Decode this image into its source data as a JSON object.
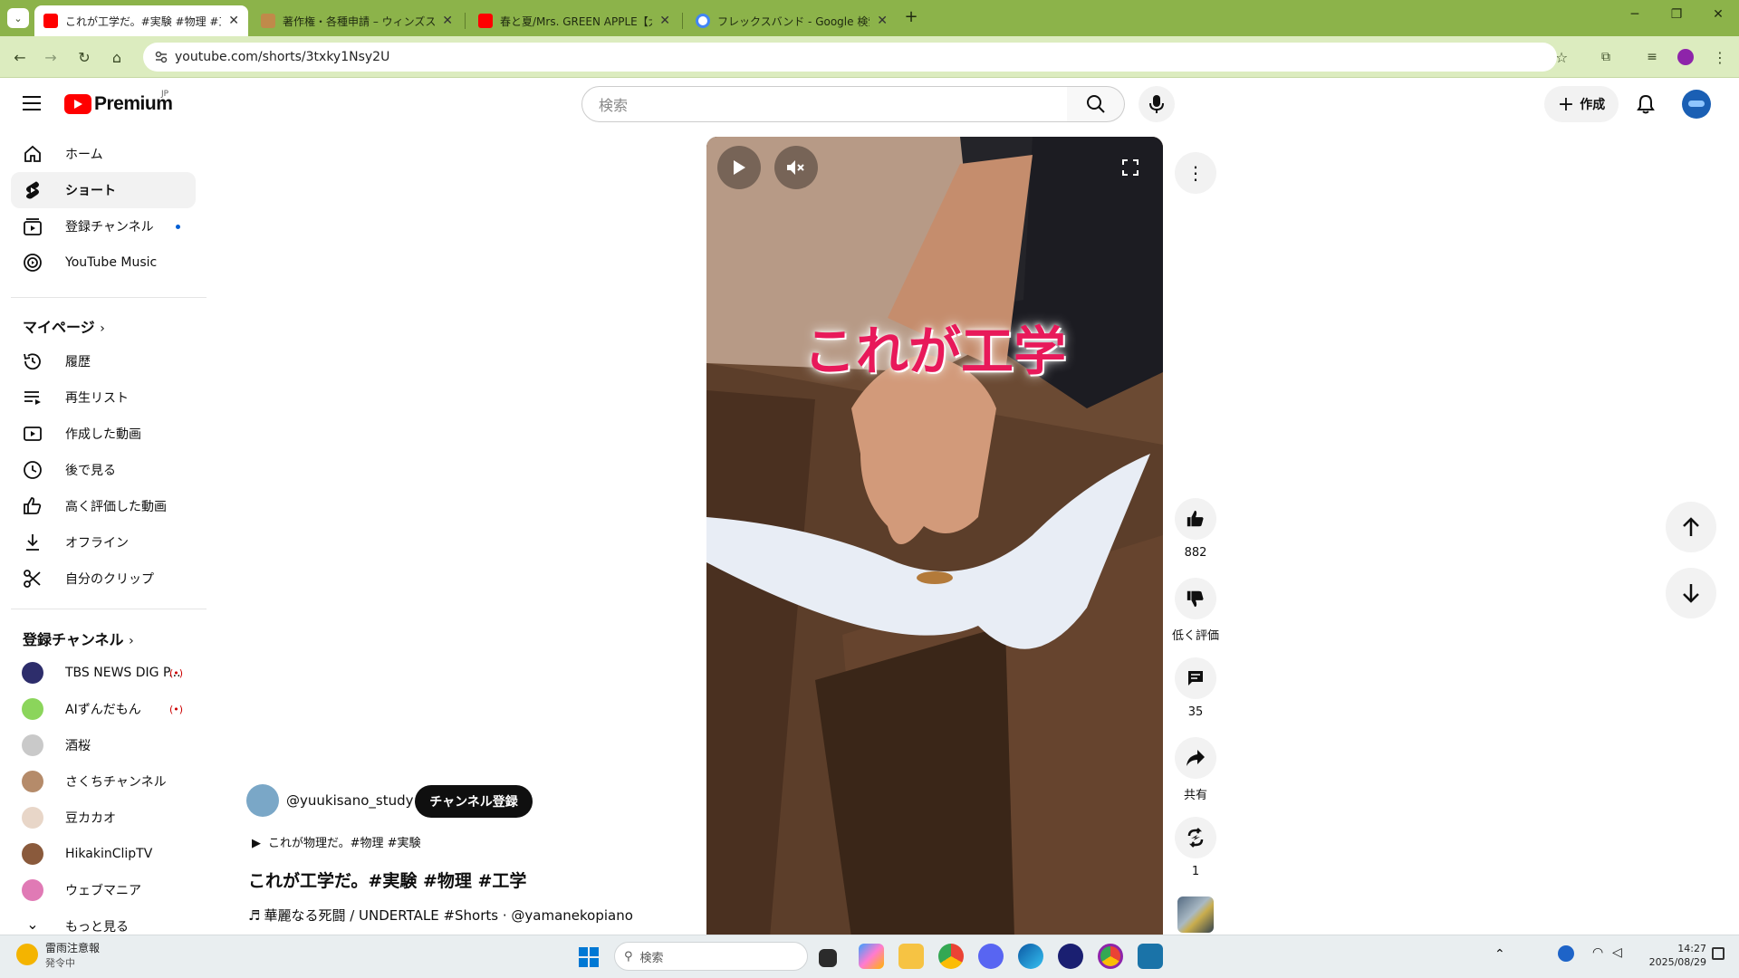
{
  "browser": {
    "tabs": [
      {
        "title": "これが工学だ。#実験 #物理 #工学",
        "favicon_color": "#ff0000"
      },
      {
        "title": "著作権・各種申請 – ウィンズスコア",
        "favicon_color": "#c08a4a"
      },
      {
        "title": "春と夏/Mrs. GREEN APPLE【大阪",
        "favicon_color": "#ff0000"
      },
      {
        "title": "フレックスバンド - Google 検索",
        "favicon_color": "#4285f4"
      }
    ],
    "url": "youtube.com/shorts/3txky1Nsy2U"
  },
  "header": {
    "logo_text": "Premium",
    "region": "JP",
    "search_placeholder": "検索",
    "create_label": "作成"
  },
  "sidebar": {
    "main": [
      {
        "label": "ホーム",
        "icon": "home-icon"
      },
      {
        "label": "ショート",
        "icon": "shorts-icon"
      },
      {
        "label": "登録チャンネル",
        "icon": "subscriptions-icon"
      },
      {
        "label": "YouTube Music",
        "icon": "music-icon"
      }
    ],
    "mypage_heading": "マイページ",
    "mypage": [
      {
        "label": "履歴",
        "icon": "history-icon"
      },
      {
        "label": "再生リスト",
        "icon": "playlist-icon"
      },
      {
        "label": "作成した動画",
        "icon": "your-videos-icon"
      },
      {
        "label": "後で見る",
        "icon": "watch-later-icon"
      },
      {
        "label": "高く評価した動画",
        "icon": "liked-videos-icon"
      },
      {
        "label": "オフライン",
        "icon": "download-icon"
      },
      {
        "label": "自分のクリップ",
        "icon": "clips-icon"
      }
    ],
    "subs_heading": "登録チャンネル",
    "subs": [
      {
        "label": "TBS NEWS DIG P...",
        "live": "(•)",
        "color": "#2d2d6b"
      },
      {
        "label": "AIずんだもん",
        "live": "(•)",
        "color": "#8bd55b"
      },
      {
        "label": "酒桜",
        "live": "",
        "color": "#c9c9c9"
      },
      {
        "label": "さくちチャンネル",
        "live": "",
        "color": "#b58b6a"
      },
      {
        "label": "豆カカオ",
        "live": "",
        "color": "#e8d6c8"
      },
      {
        "label": "HikakinClipTV",
        "live": "",
        "color": "#8a5a3c"
      },
      {
        "label": "ウェブマニア",
        "live": "",
        "color": "#e07ab5"
      }
    ],
    "more_label": "もっと見る"
  },
  "video": {
    "overlay_text": "これが工学",
    "channel": "@yuukisano_study",
    "subscribe_label": "チャンネル登録",
    "description": "これが物理だ。#物理 #実験",
    "title": "これが工学だ。#実験 #物理 #工学",
    "music": "華麗なる死闘 / UNDERTALE #Shorts · @yamanekopiano"
  },
  "actions": {
    "likes": "882",
    "dislike_label": "低く評価",
    "comments": "35",
    "share_label": "共有",
    "remix_count": "1"
  },
  "taskbar": {
    "weather_title": "雷雨注意報",
    "weather_sub": "発令中",
    "search_placeholder": "検索",
    "time": "14:27",
    "date": "2025/08/29"
  }
}
